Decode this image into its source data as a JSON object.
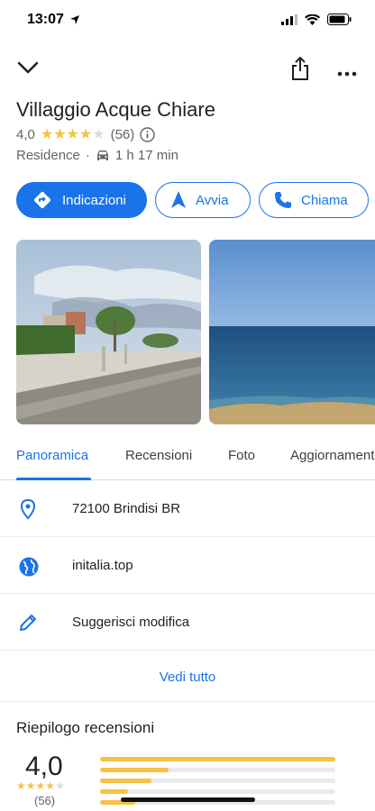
{
  "status": {
    "time": "13:07"
  },
  "place": {
    "title": "Villaggio Acque Chiare",
    "rating": "4,0",
    "stars": [
      1,
      1,
      1,
      1,
      0
    ],
    "review_count": "(56)",
    "category": "Residence",
    "separator": "·",
    "drive_time": "1 h 17 min"
  },
  "actions": [
    {
      "label": "Indicazioni",
      "icon": "directions-icon"
    },
    {
      "label": "Avvia",
      "icon": "navigation-arrow-icon"
    },
    {
      "label": "Chiama",
      "icon": "phone-icon"
    }
  ],
  "tabs": [
    {
      "label": "Panoramica",
      "active": true
    },
    {
      "label": "Recensioni",
      "active": false
    },
    {
      "label": "Foto",
      "active": false
    },
    {
      "label": "Aggiornamenti",
      "active": false
    }
  ],
  "info_rows": [
    {
      "icon": "location-pin-icon",
      "text": "72100 Brindisi BR"
    },
    {
      "icon": "globe-icon",
      "text": "initalia.top"
    },
    {
      "icon": "edit-pencil-icon",
      "text": "Suggerisci modifica"
    }
  ],
  "see_all": "Vedi tutto",
  "reviews_summary": {
    "title": "Riepilogo recensioni",
    "rating": "4,0",
    "count": "(56)",
    "distribution_fraction": [
      1.0,
      0.29,
      0.22,
      0.12,
      0.15
    ]
  },
  "colors": {
    "accent": "#1a73e8",
    "star": "#f6c244",
    "star_empty": "#dadce0"
  }
}
